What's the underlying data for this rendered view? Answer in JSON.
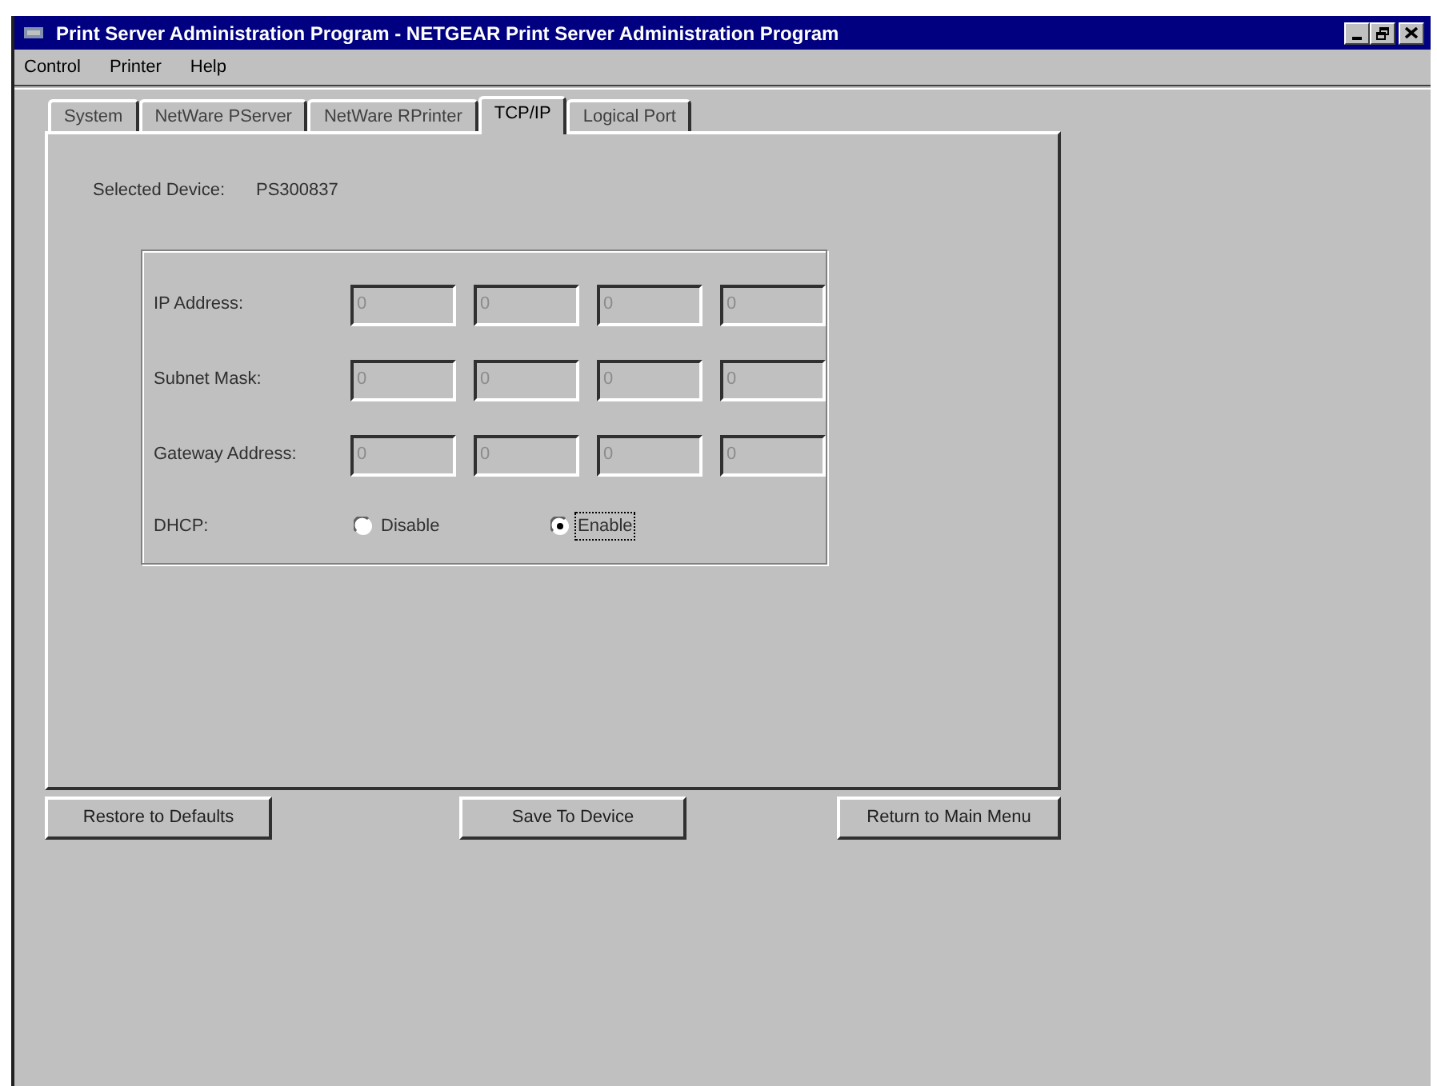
{
  "window": {
    "title": "Print Server Administration Program - NETGEAR Print Server Administration Program"
  },
  "menu": [
    "Control",
    "Printer",
    "Help"
  ],
  "tabs": [
    {
      "label": "System",
      "selected": false
    },
    {
      "label": "NetWare PServer",
      "selected": false
    },
    {
      "label": "NetWare RPrinter",
      "selected": false
    },
    {
      "label": "TCP/IP",
      "selected": true
    },
    {
      "label": "Logical Port",
      "selected": false
    }
  ],
  "selected_device": {
    "label": "Selected Device:",
    "value": "PS300837"
  },
  "tcpip": {
    "rows": [
      {
        "label": "IP Address:",
        "fields": [
          {
            "value": "0",
            "disabled": true
          },
          {
            "value": "0",
            "disabled": true
          },
          {
            "value": "0",
            "disabled": true
          },
          {
            "value": "0",
            "disabled": true
          }
        ]
      },
      {
        "label": "Subnet Mask:",
        "fields": [
          {
            "value": "0",
            "disabled": true
          },
          {
            "value": "0",
            "disabled": true
          },
          {
            "value": "0",
            "disabled": true
          },
          {
            "value": "0",
            "disabled": true
          }
        ]
      },
      {
        "label": "Gateway Address:",
        "fields": [
          {
            "value": "0",
            "disabled": true
          },
          {
            "value": "0",
            "disabled": true
          },
          {
            "value": "0",
            "disabled": true
          },
          {
            "value": "0",
            "disabled": true
          }
        ]
      }
    ],
    "dhcp": {
      "label": "DHCP:",
      "options": [
        {
          "label": "Disable",
          "selected": false,
          "focused": false
        },
        {
          "label": "Enable",
          "selected": true,
          "focused": true
        }
      ]
    }
  },
  "buttons": [
    "Restore to Defaults",
    "Save To Device",
    "Return to Main Menu"
  ]
}
